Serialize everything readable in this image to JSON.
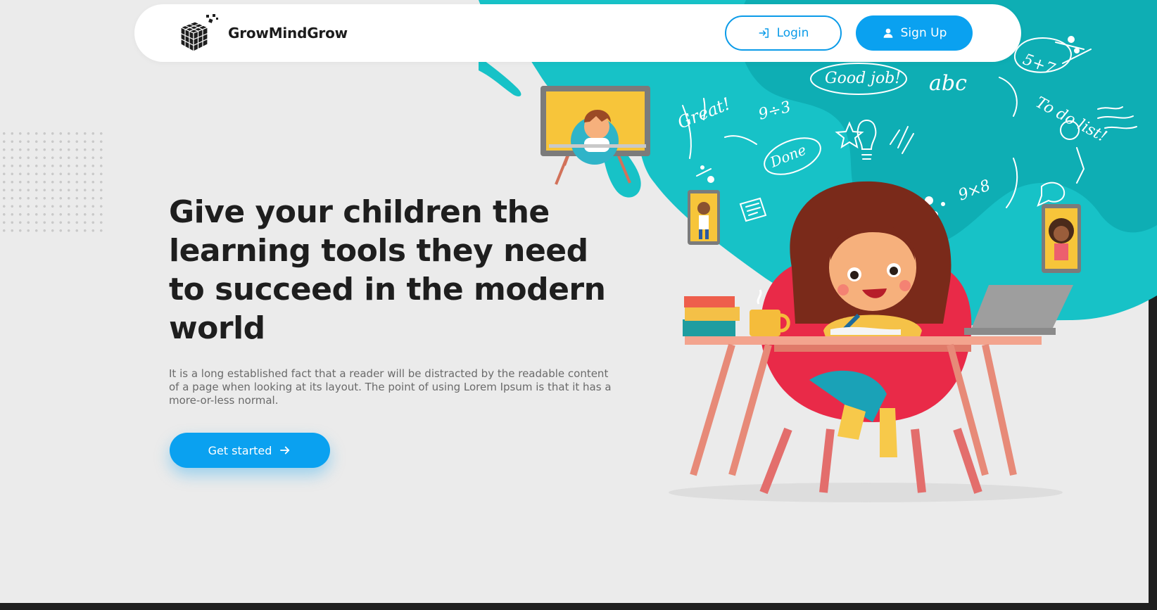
{
  "nav": {
    "brand": "GrowMindGrow",
    "logo_icon": "rubiks-cube-logo",
    "login_label": "Login",
    "login_icon": "login-icon",
    "signup_label": "Sign Up",
    "signup_icon": "user-icon"
  },
  "hero": {
    "title": "Give your children the learning tools they need to succeed in the modern world",
    "description": "It is a long established fact that a reader will be distracted by the readable content of a page when looking at its layout. The point of using Lorem Ipsum is that it has a more-or-less normal.",
    "cta_label": "Get started",
    "cta_icon": "arrow-right-icon"
  },
  "illustration": {
    "doodles": [
      "Good job!",
      "abc",
      "Great!",
      "Done",
      "To do list!"
    ],
    "math": [
      "5+7",
      "9÷3",
      "9×8"
    ]
  },
  "colors": {
    "accent": "#0aa1f0",
    "teal": "#17c2c7",
    "background": "#ebebeb"
  }
}
